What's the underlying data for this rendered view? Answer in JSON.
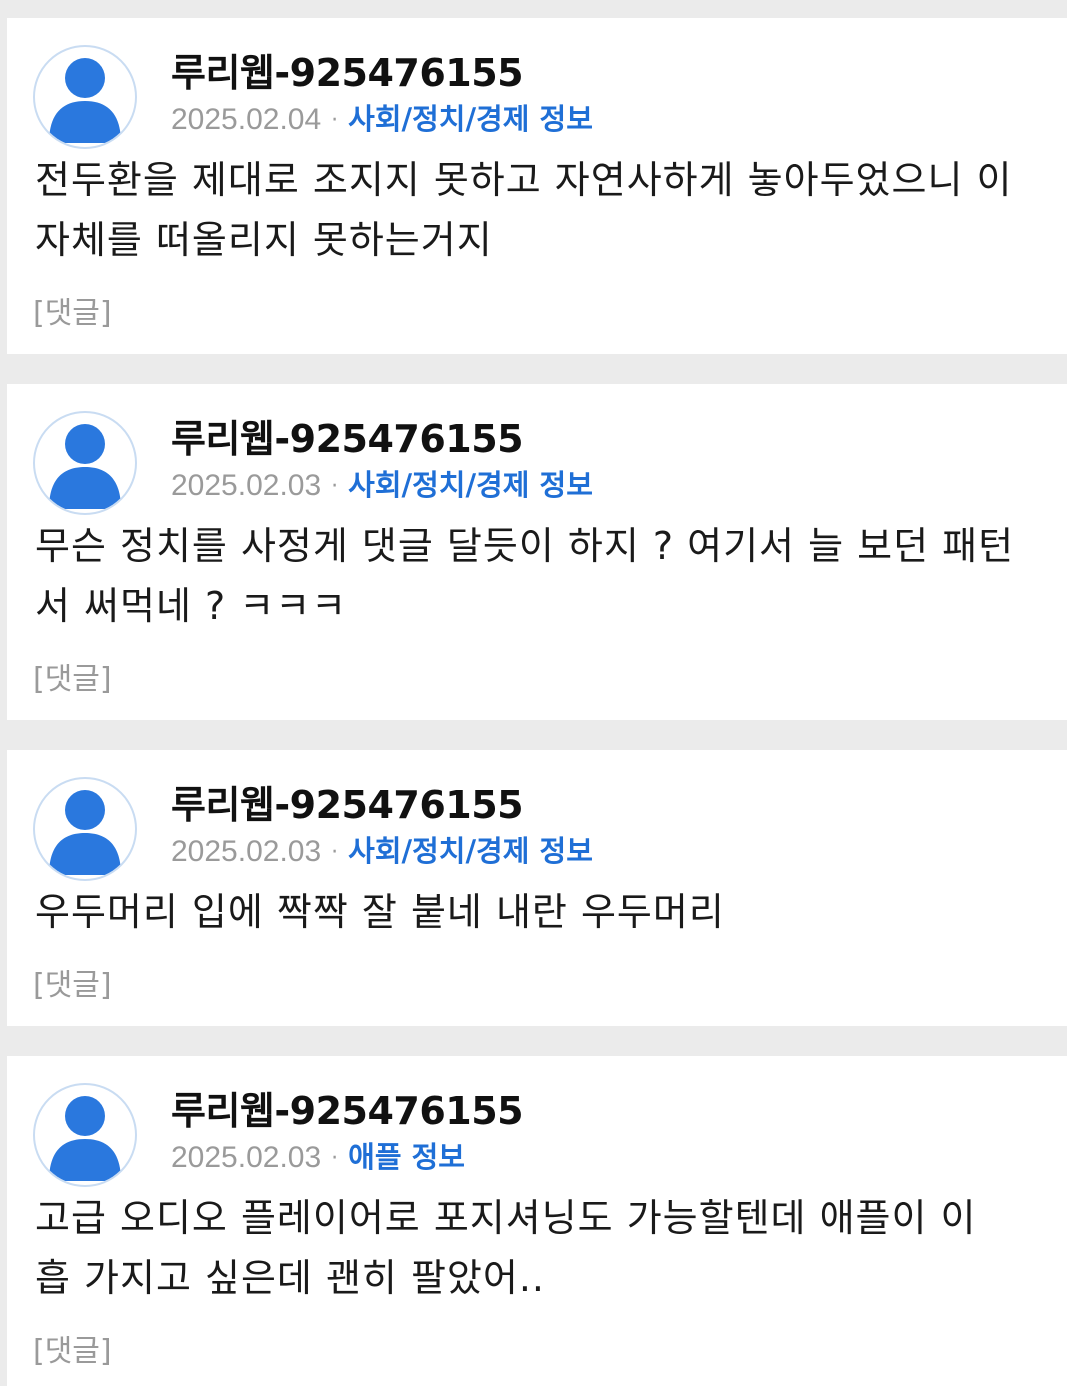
{
  "posts": [
    {
      "author": "루리웹-925476155",
      "date": "2025.02.04",
      "separator": "·",
      "category": "사회/정치/경제 정보",
      "lines": [
        "전두환을 제대로 조지지 못하고 자연사하게 놓아두었으니 이",
        "자체를 떠올리지 못하는거지"
      ],
      "comment_label": "[댓글]"
    },
    {
      "author": "루리웹-925476155",
      "date": "2025.02.03",
      "separator": "·",
      "category": "사회/정치/경제 정보",
      "lines": [
        "무슨 정치를 사정게 댓글 달듯이 하지 ? 여기서 늘 보던 패턴",
        "서 써먹네 ? ㅋㅋㅋ"
      ],
      "comment_label": "[댓글]"
    },
    {
      "author": "루리웹-925476155",
      "date": "2025.02.03",
      "separator": "·",
      "category": "사회/정치/경제 정보",
      "lines": [
        "우두머리 입에 짝짝 잘 붙네 내란 우두머리"
      ],
      "comment_label": "[댓글]"
    },
    {
      "author": "루리웹-925476155",
      "date": "2025.02.03",
      "separator": "·",
      "category": "애플 정보",
      "lines": [
        "고급 오디오 플레이어로 포지셔닝도 가능할텐데 애플이 이",
        "흡 가지고 싶은데 괜히 팔았어.."
      ],
      "comment_label": "[댓글]"
    }
  ],
  "colors": {
    "accent": "#1f6fd6",
    "avatar_fill": "#2a78de",
    "muted": "#9a9a9a",
    "background": "#ebebeb"
  },
  "icons": {
    "avatar": "user-avatar-icon"
  }
}
